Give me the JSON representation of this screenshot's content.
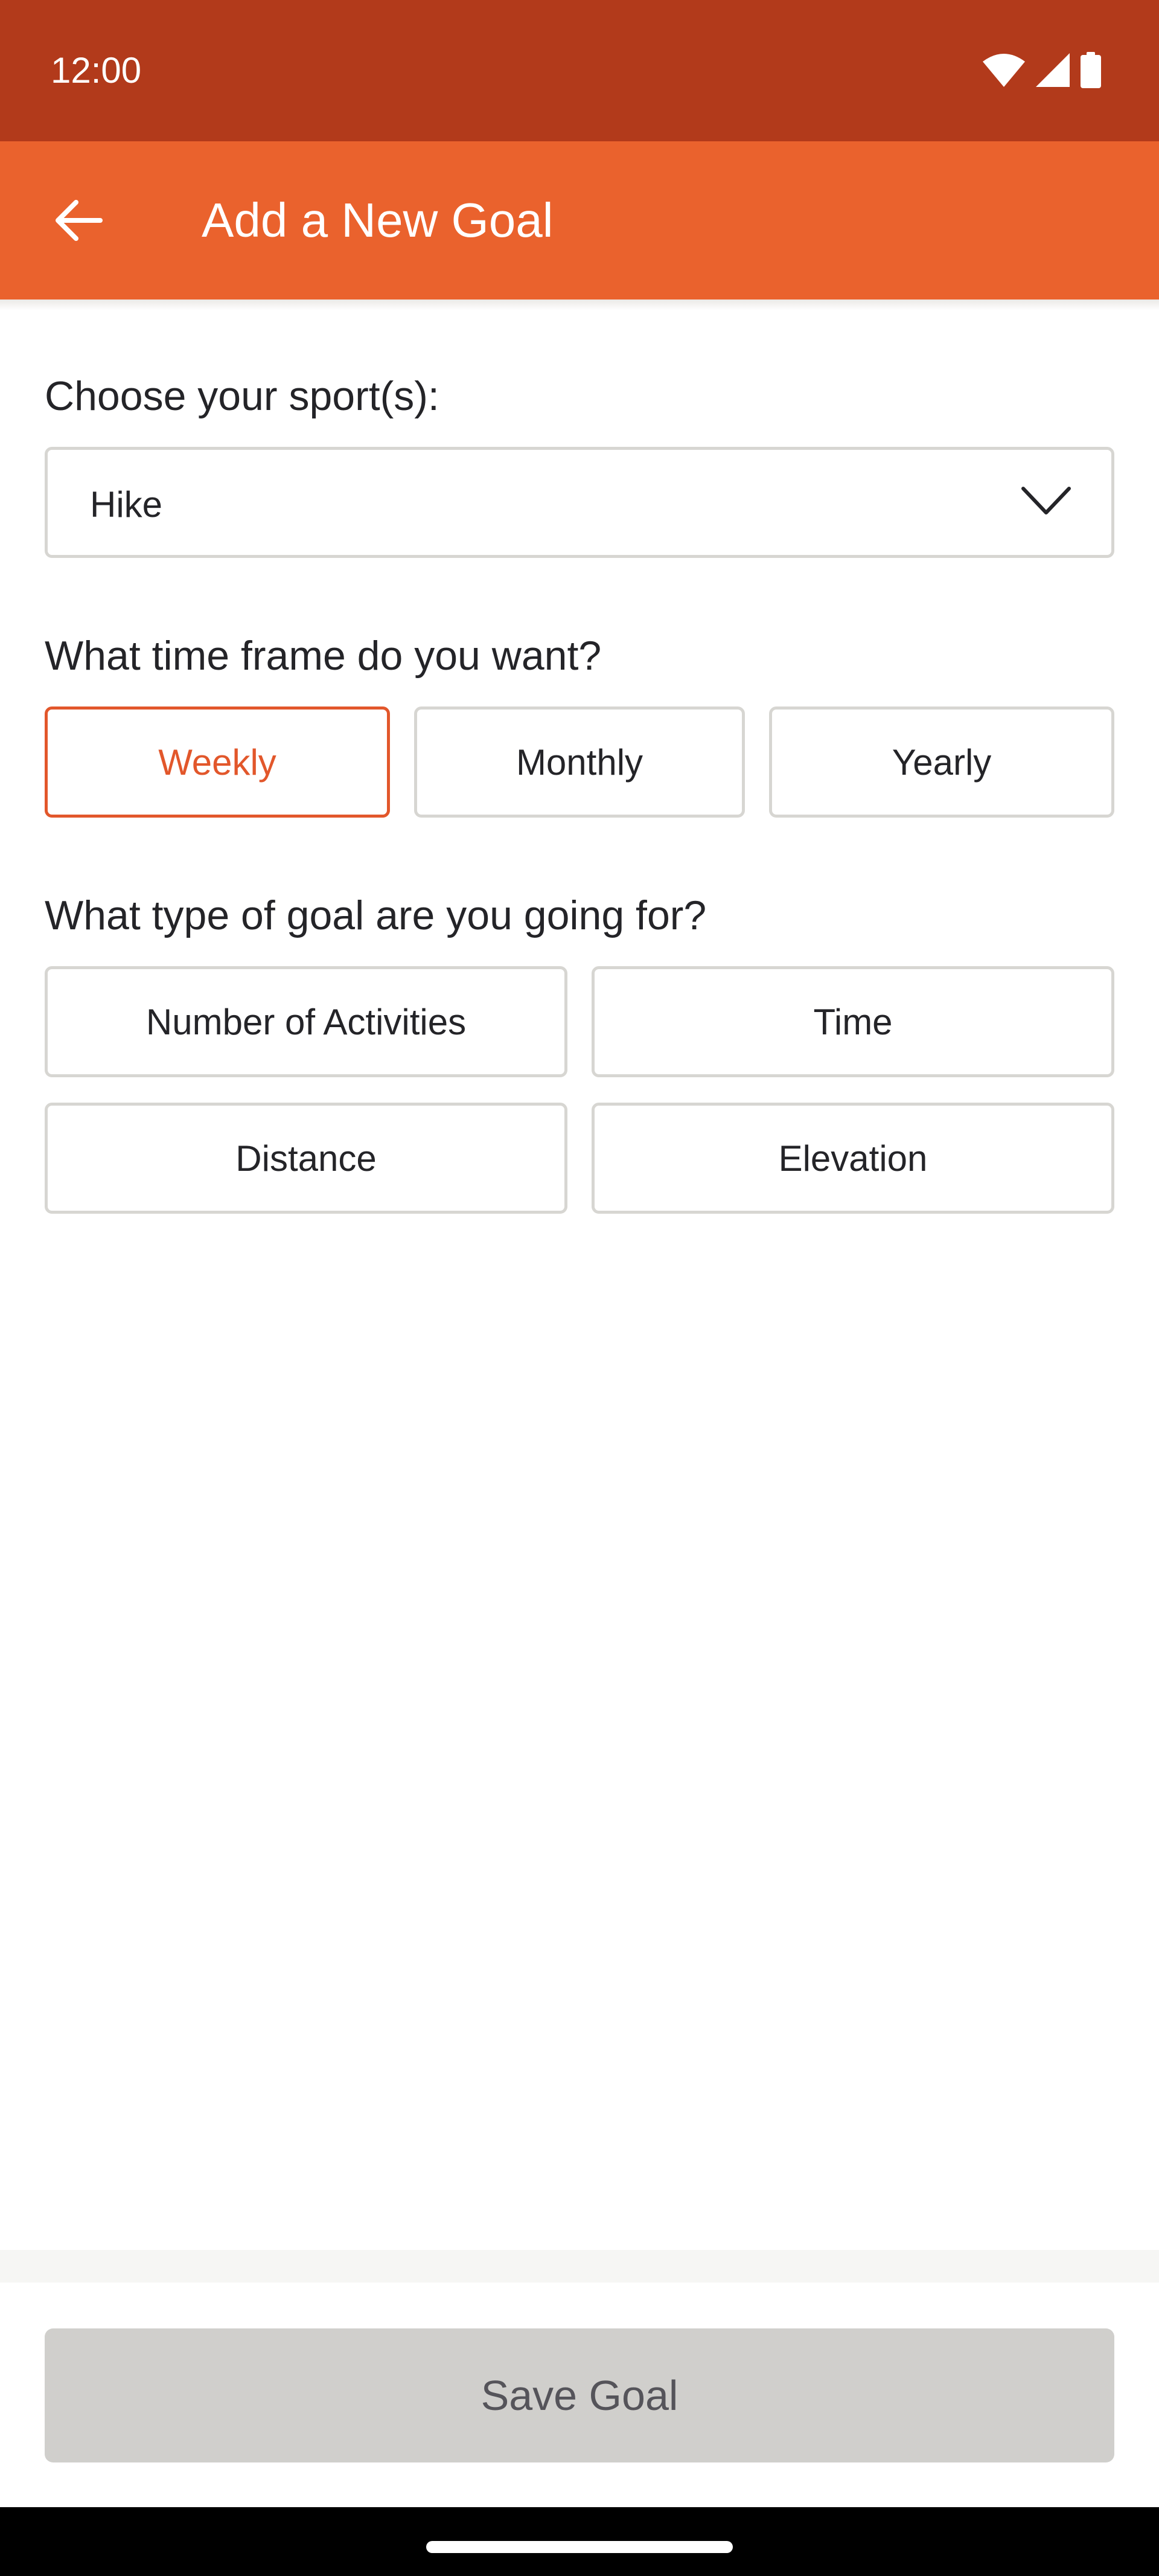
{
  "status_bar": {
    "time": "12:00",
    "icons": [
      "wifi-icon",
      "cellular-signal-icon",
      "battery-icon"
    ]
  },
  "app_bar": {
    "title": "Add a New Goal",
    "back_icon": "arrow-left-icon"
  },
  "sport": {
    "label": "Choose your sport(s):",
    "selected_value": "Hike",
    "dropdown_icon": "chevron-down-icon"
  },
  "time_frame": {
    "label": "What time frame do you want?",
    "options": [
      {
        "label": "Weekly",
        "selected": true
      },
      {
        "label": "Monthly",
        "selected": false
      },
      {
        "label": "Yearly",
        "selected": false
      }
    ]
  },
  "goal_type": {
    "label": "What type of goal are you going for?",
    "options": [
      {
        "label": "Number of Activities",
        "selected": false
      },
      {
        "label": "Time",
        "selected": false
      },
      {
        "label": "Distance",
        "selected": false
      },
      {
        "label": "Elevation",
        "selected": false
      }
    ]
  },
  "footer": {
    "save_label": "Save Goal"
  },
  "colors": {
    "status_bar": "#B23A1B",
    "app_bar": "#EA622D",
    "accent": "#E2572B",
    "border": "#D7D6D2",
    "disabled_button": "#D0CFCC"
  }
}
